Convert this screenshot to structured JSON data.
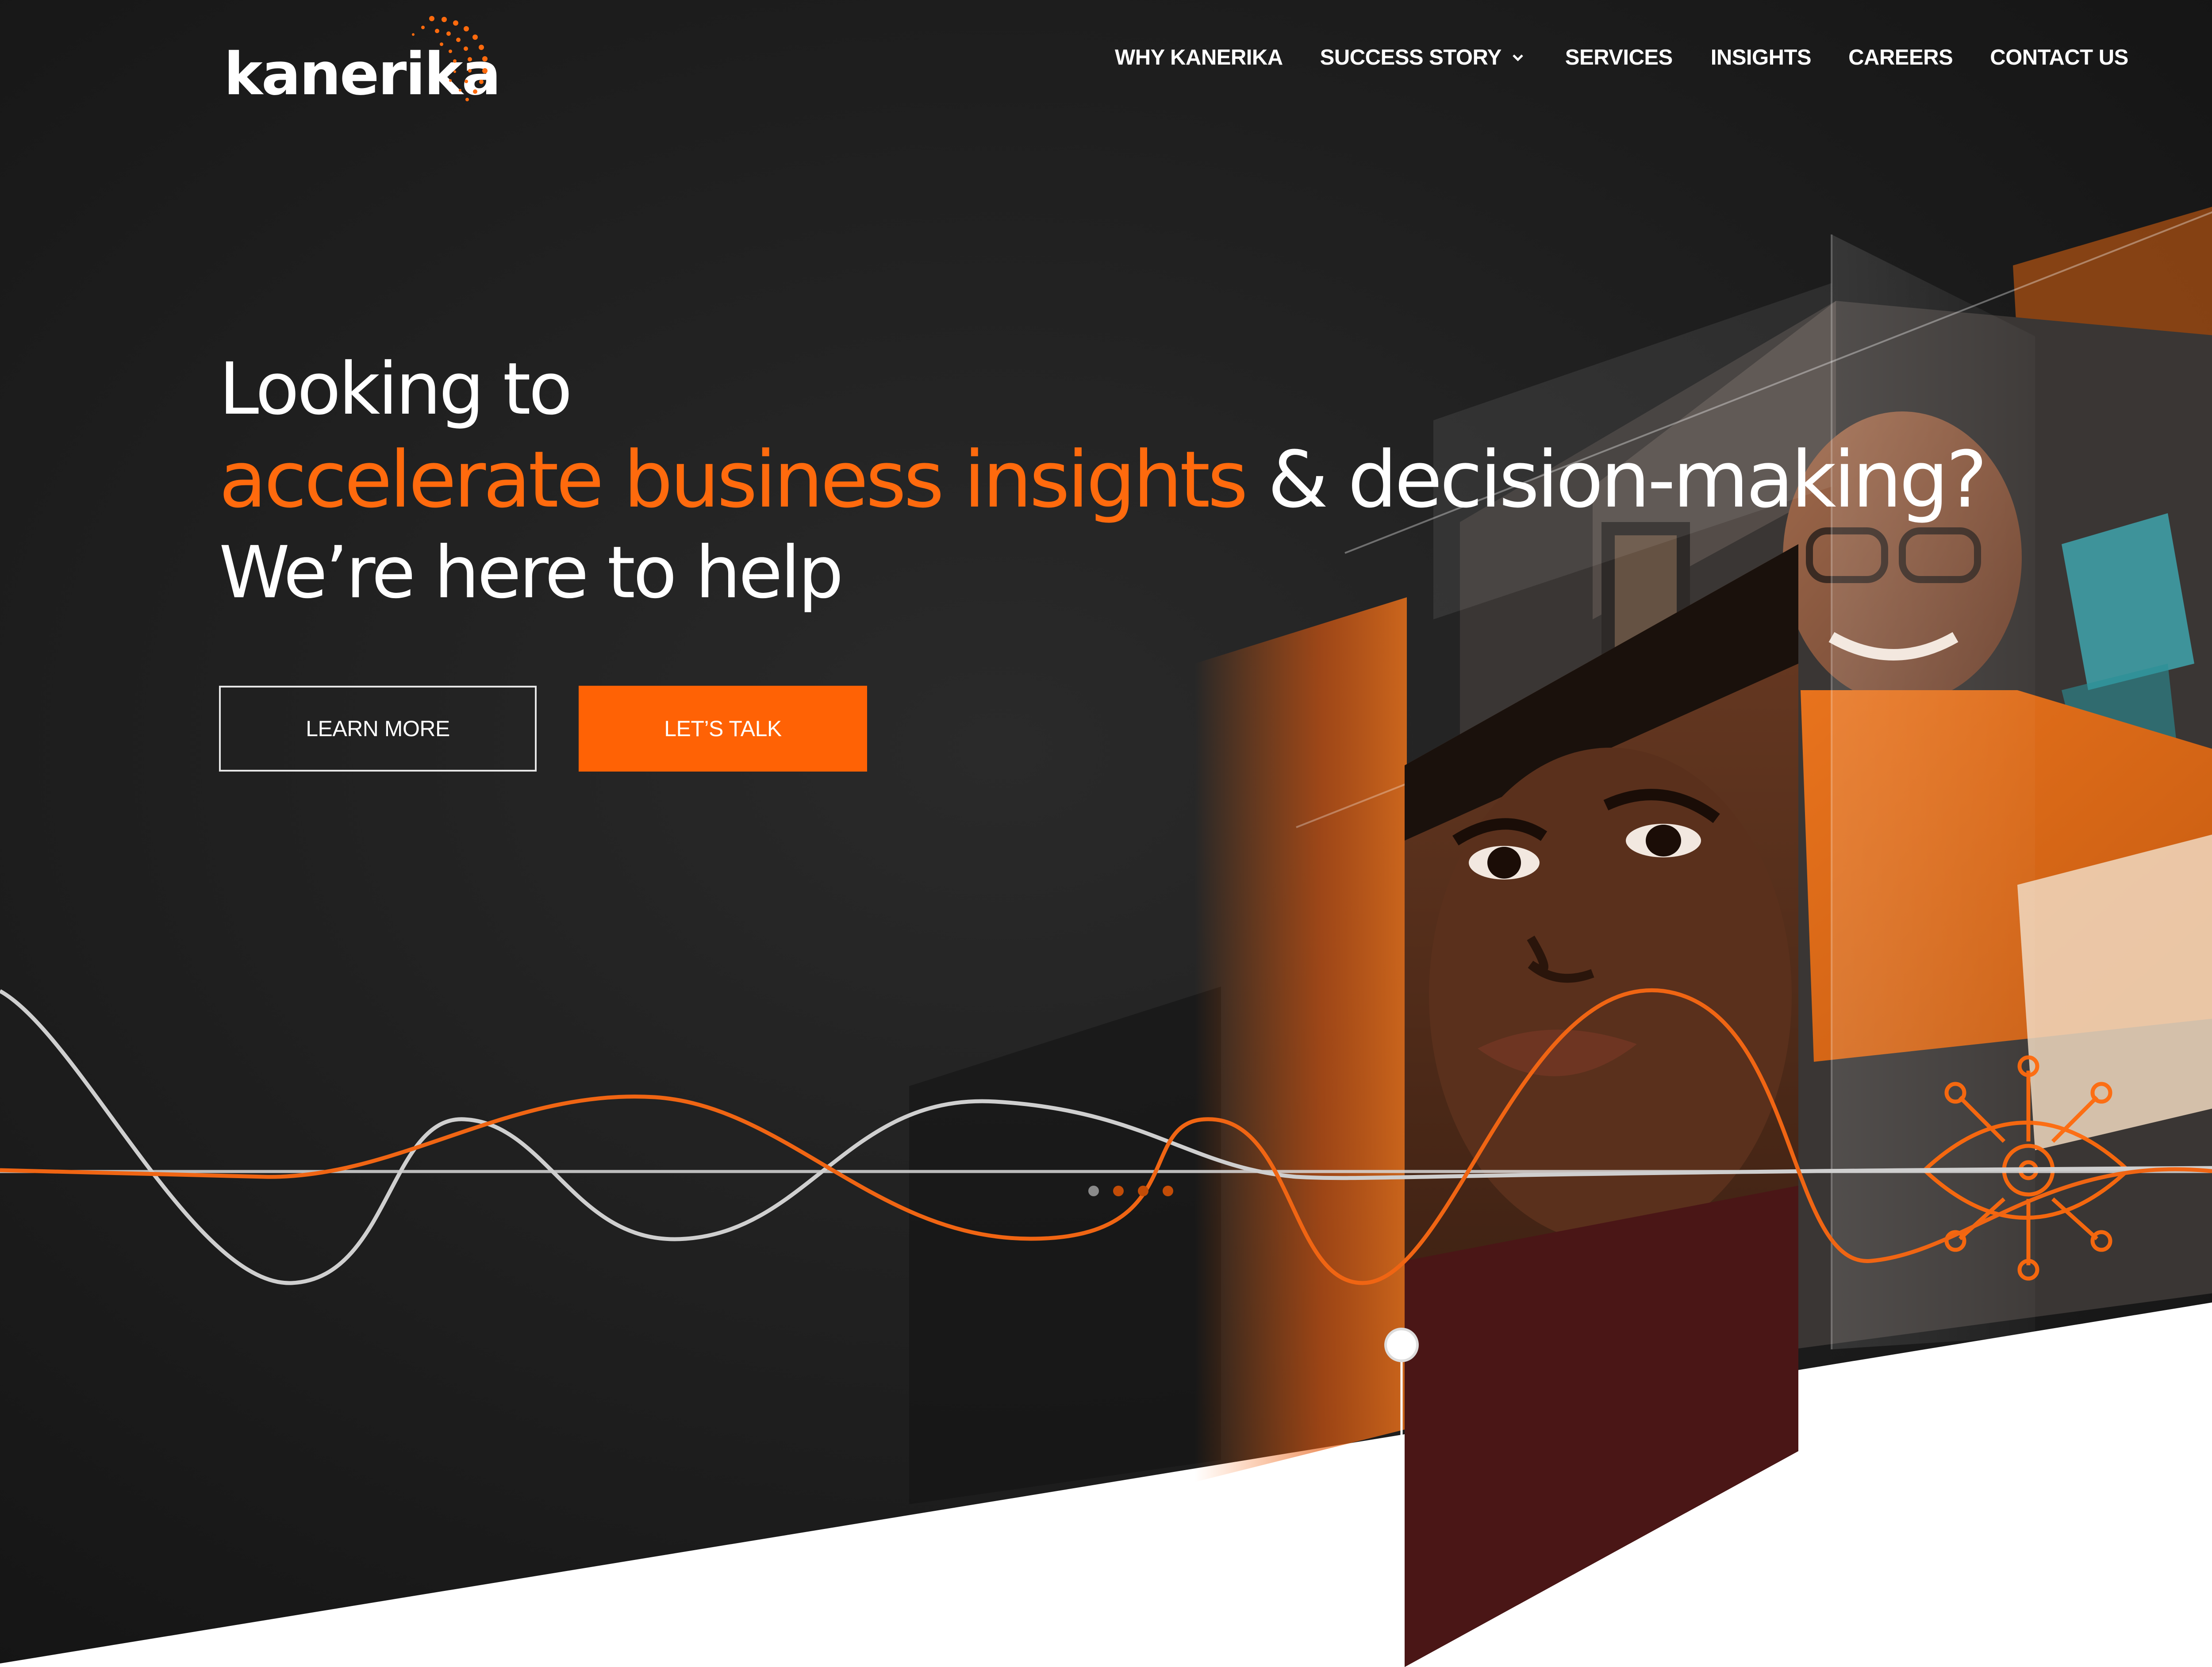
{
  "brand": {
    "logo_text": "kanerika"
  },
  "nav": {
    "items": [
      {
        "label": "WHY KANERIKA",
        "has_dropdown": false
      },
      {
        "label": "SUCCESS STORY",
        "has_dropdown": true
      },
      {
        "label": "SERVICES",
        "has_dropdown": false
      },
      {
        "label": "INSIGHTS",
        "has_dropdown": false
      },
      {
        "label": "CAREERS",
        "has_dropdown": false
      },
      {
        "label": "CONTACT US",
        "has_dropdown": false
      }
    ]
  },
  "hero": {
    "line1": "Looking to",
    "line2_accent": "accelerate business insights",
    "line2_rest": " & decision-making?",
    "line3": "We’re here to help"
  },
  "buttons": {
    "learn_more": "LEARN MORE",
    "lets_talk": "LET’S TALK"
  },
  "slider": {
    "dot_count": 4,
    "active_index": 0
  },
  "icons": [
    "chevron-down-icon",
    "eye-network-icon"
  ],
  "colors": {
    "accent": "#ff6a0d",
    "button_orange": "#ff6205",
    "background_dark": "#1d1d1d",
    "text_light": "#ffffff"
  }
}
